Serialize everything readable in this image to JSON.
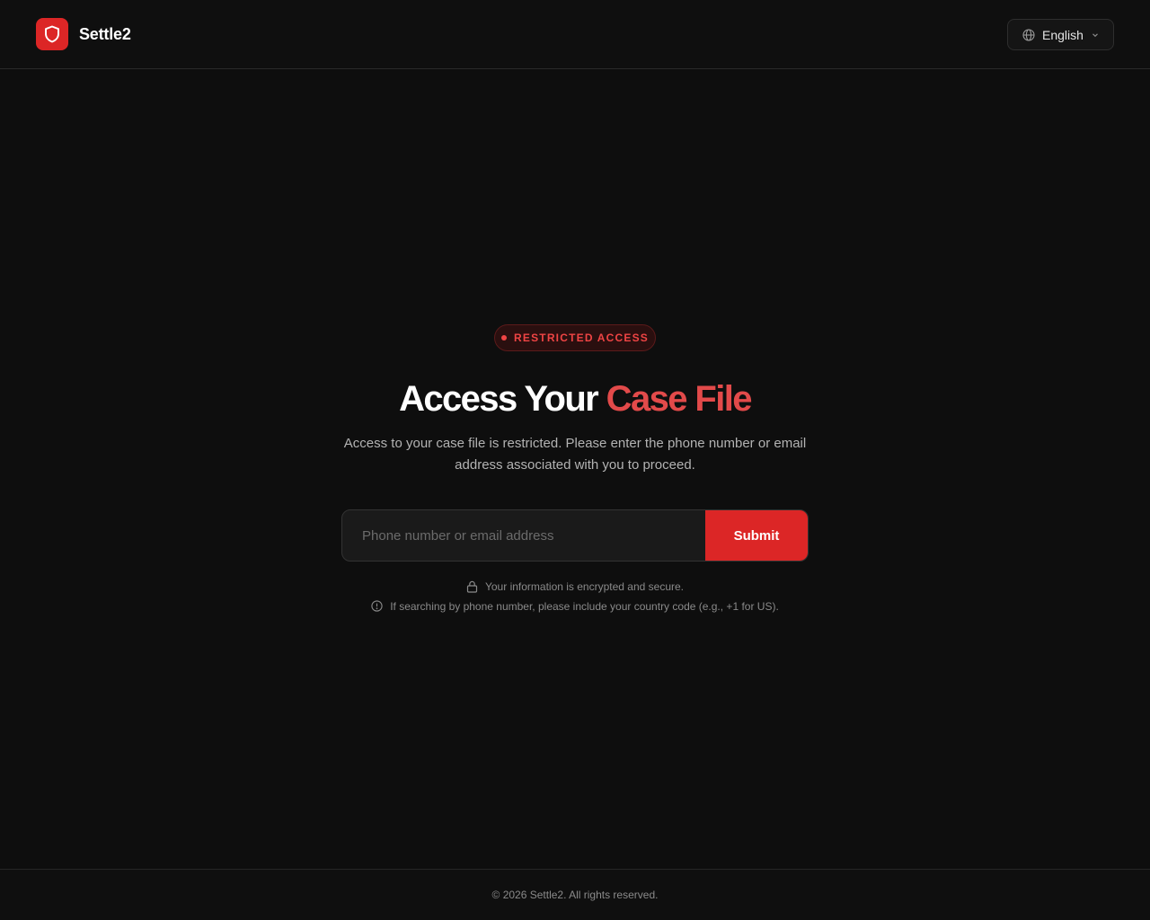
{
  "header": {
    "brand_name": "Settle2",
    "logo_icon": "shield-icon",
    "language": {
      "icon": "globe-icon",
      "selected": "English",
      "chevron_icon": "chevron-down-icon"
    }
  },
  "main": {
    "badge": "RESTRICTED ACCESS",
    "title_part1": "Access Your ",
    "title_part2": "Case File",
    "description": "Access to your case file is restricted. Please enter the phone number or email address associated with you to proceed.",
    "input_placeholder": "Phone number or email address",
    "input_value": "",
    "submit_label": "Submit",
    "note_secure": "Your information is encrypted and secure.",
    "note_secure_icon": "lock-icon",
    "note_phone": "If searching by phone number, please include your country code (e.g., +1 for US).",
    "note_phone_icon": "info-icon"
  },
  "footer": {
    "copyright": "© 2026 Settle2. All rights reserved."
  },
  "colors": {
    "accent": "#dc2626",
    "accent_text": "#e24a4a",
    "background": "#0e0e0e"
  }
}
